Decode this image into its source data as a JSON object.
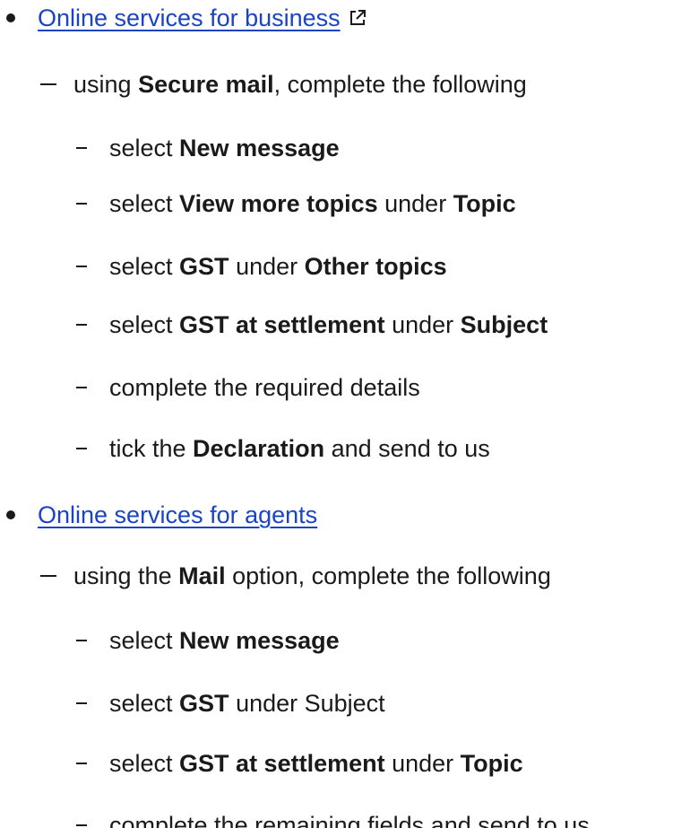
{
  "items": [
    {
      "level": 1,
      "link": "Online services for business",
      "external": true,
      "icon": "external-link-icon"
    },
    {
      "level": 2,
      "segments": [
        {
          "t": "using "
        },
        {
          "t": "Secure mail",
          "b": true
        },
        {
          "t": ", complete the following"
        }
      ]
    },
    {
      "level": 3,
      "segments": [
        {
          "t": "select "
        },
        {
          "t": "New message",
          "b": true
        }
      ]
    },
    {
      "level": 3,
      "segments": [
        {
          "t": "select "
        },
        {
          "t": "View more topics",
          "b": true
        },
        {
          "t": " under "
        },
        {
          "t": "Topic",
          "b": true
        }
      ]
    },
    {
      "level": 3,
      "segments": [
        {
          "t": "select "
        },
        {
          "t": "GST",
          "b": true
        },
        {
          "t": " under "
        },
        {
          "t": "Other topics",
          "b": true
        }
      ]
    },
    {
      "level": 3,
      "segments": [
        {
          "t": "select "
        },
        {
          "t": "GST at settlement",
          "b": true
        },
        {
          "t": " under "
        },
        {
          "t": "Subject",
          "b": true
        }
      ]
    },
    {
      "level": 3,
      "segments": [
        {
          "t": "complete the required details"
        }
      ]
    },
    {
      "level": 3,
      "segments": [
        {
          "t": "tick the "
        },
        {
          "t": "Declaration",
          "b": true
        },
        {
          "t": " and send to us"
        }
      ]
    },
    {
      "level": 1,
      "link": "Online services for agents",
      "external": false
    },
    {
      "level": 2,
      "segments": [
        {
          "t": "using the "
        },
        {
          "t": "Mail",
          "b": true
        },
        {
          "t": " option, complete the following"
        }
      ]
    },
    {
      "level": 3,
      "segments": [
        {
          "t": "select "
        },
        {
          "t": "New message",
          "b": true
        }
      ]
    },
    {
      "level": 3,
      "segments": [
        {
          "t": "select "
        },
        {
          "t": "GST",
          "b": true
        },
        {
          "t": " under Subject"
        }
      ]
    },
    {
      "level": 3,
      "segments": [
        {
          "t": "select "
        },
        {
          "t": "GST at settlement",
          "b": true
        },
        {
          "t": " under "
        },
        {
          "t": "Topic",
          "b": true
        }
      ]
    },
    {
      "level": 3,
      "segments": [
        {
          "t": "complete the remaining fields and send to us."
        }
      ]
    }
  ]
}
